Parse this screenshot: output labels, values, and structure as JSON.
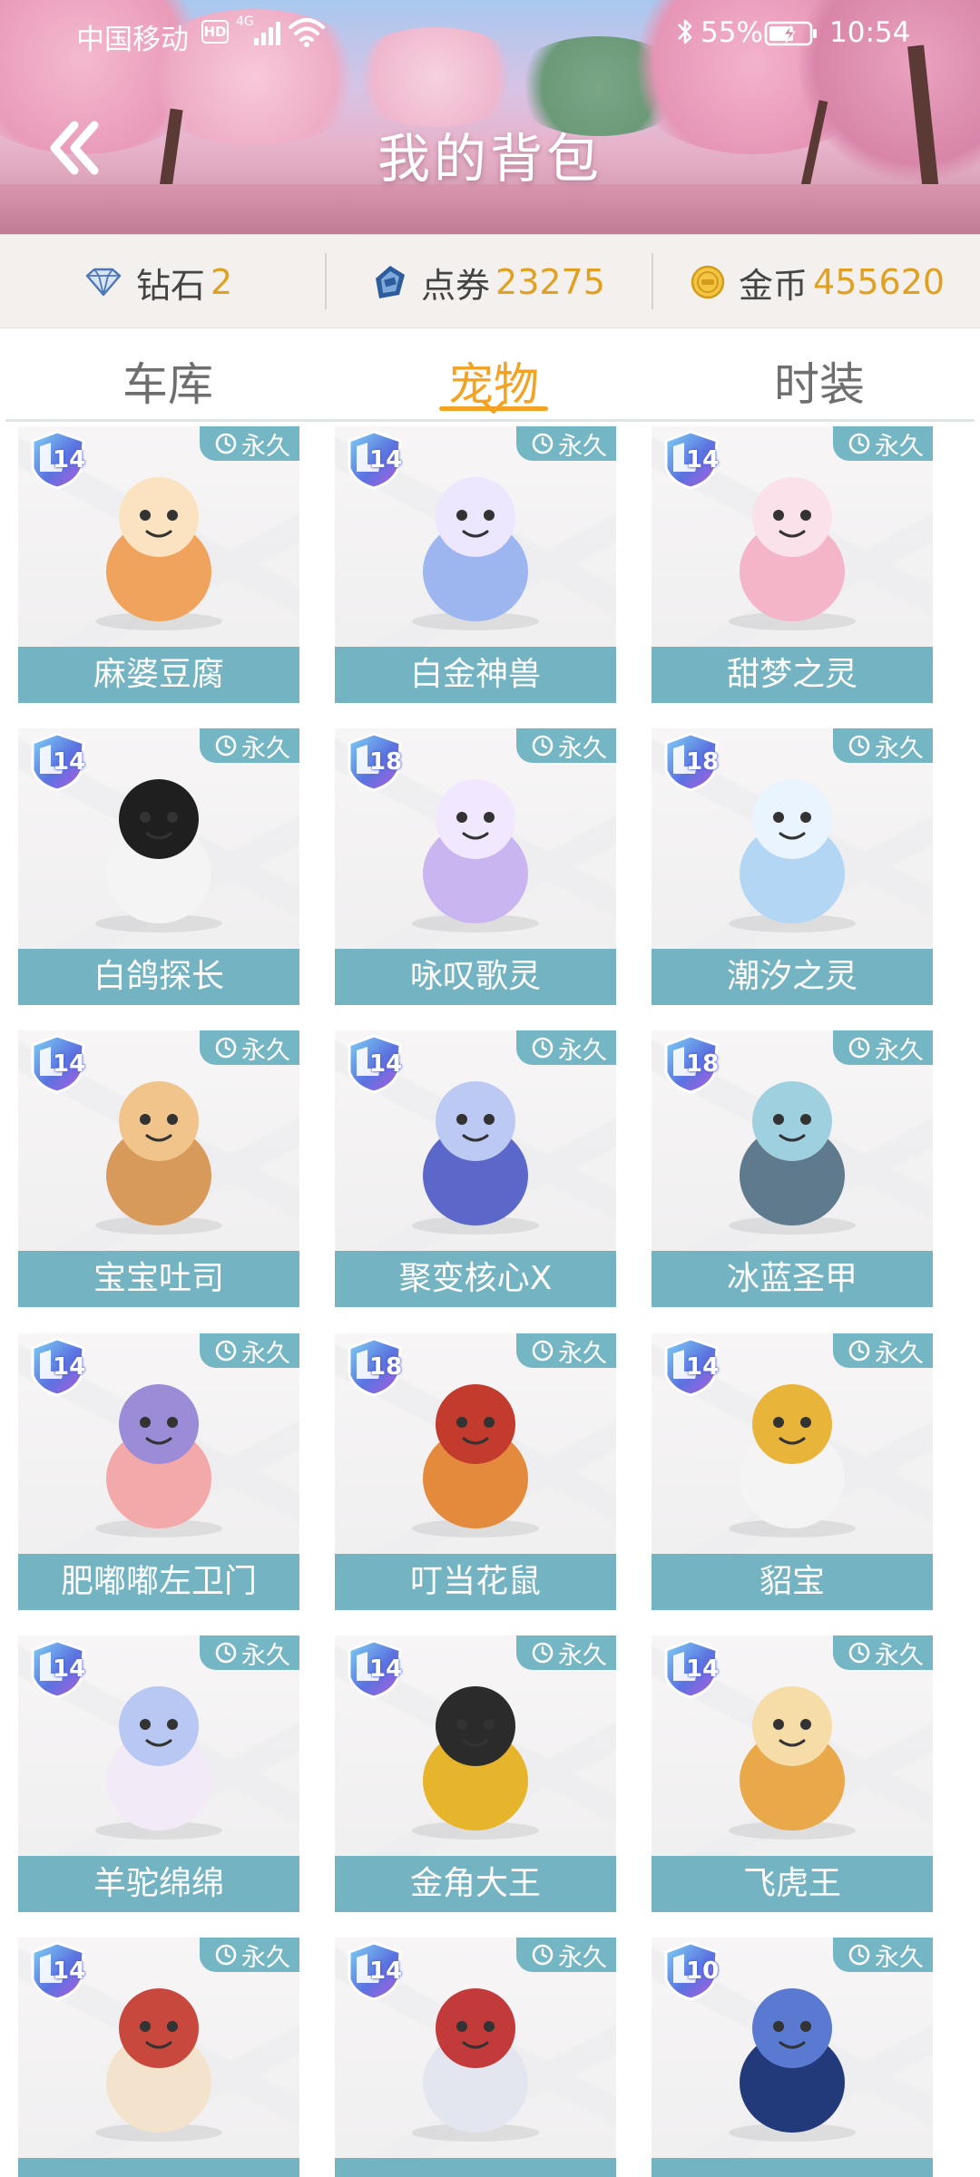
{
  "status_bar": {
    "carrier": "中国移动",
    "hd": "HD",
    "network": "4G",
    "battery_percent": "55%",
    "time": "10:54"
  },
  "header": {
    "title": "我的背包",
    "back_icon": "double-chevron-left-icon"
  },
  "currency": [
    {
      "icon": "diamond-icon",
      "label": "钻石",
      "value": "2"
    },
    {
      "icon": "voucher-icon",
      "label": "点券",
      "value": "23275"
    },
    {
      "icon": "coin-icon",
      "label": "金币",
      "value": "455620"
    }
  ],
  "tabs": [
    {
      "label": "车库",
      "active": false
    },
    {
      "label": "宠物",
      "active": true
    },
    {
      "label": "时装",
      "active": false
    }
  ],
  "pets": [
    {
      "name": "麻婆豆腐",
      "level": "14",
      "duration": "永久"
    },
    {
      "name": "白金神兽",
      "level": "14",
      "duration": "永久"
    },
    {
      "name": "甜梦之灵",
      "level": "14",
      "duration": "永久"
    },
    {
      "name": "白鸽探长",
      "level": "14",
      "duration": "永久"
    },
    {
      "name": "咏叹歌灵",
      "level": "18",
      "duration": "永久"
    },
    {
      "name": "潮汐之灵",
      "level": "18",
      "duration": "永久"
    },
    {
      "name": "宝宝吐司",
      "level": "14",
      "duration": "永久"
    },
    {
      "name": "聚变核心X",
      "level": "14",
      "duration": "永久"
    },
    {
      "name": "冰蓝圣甲",
      "level": "18",
      "duration": "永久"
    },
    {
      "name": "肥嘟嘟左卫门",
      "level": "14",
      "duration": "永久"
    },
    {
      "name": "叮当花鼠",
      "level": "18",
      "duration": "永久"
    },
    {
      "name": "貂宝",
      "level": "14",
      "duration": "永久"
    },
    {
      "name": "羊驼绵绵",
      "level": "14",
      "duration": "永久"
    },
    {
      "name": "金角大王",
      "level": "14",
      "duration": "永久"
    },
    {
      "name": "飞虎王",
      "level": "14",
      "duration": "永久"
    },
    {
      "name": "",
      "level": "14",
      "duration": "永久"
    },
    {
      "name": "",
      "level": "14",
      "duration": "永久"
    },
    {
      "name": "",
      "level": "10",
      "duration": "永久"
    }
  ],
  "colors": {
    "accent": "#f3a223",
    "card_label_bg": "#73b3c2",
    "currency_value": "#e0a123"
  }
}
